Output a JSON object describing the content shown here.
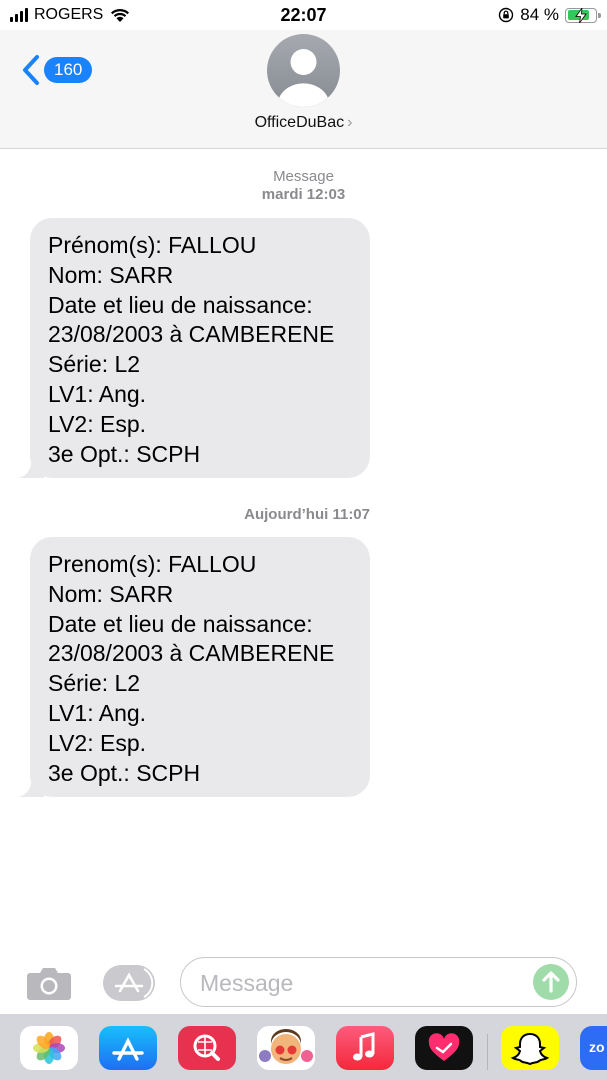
{
  "status_bar": {
    "carrier": "ROGERS",
    "time": "22:07",
    "battery_percent": "84 %",
    "battery_level": 0.84
  },
  "header": {
    "back_count": "160",
    "contact_name": "OfficeDuBac",
    "chevron": "›"
  },
  "messages": [
    {
      "timestamp_label": "Message",
      "timestamp": "mardi 12:03",
      "lines": [
        "Prénom(s): FALLOU",
        "Nom: SARR",
        "Date et lieu de naissance:",
        "23/08/2003 à CAMBERENE",
        "Série: L2",
        "LV1: Ang.",
        "LV2: Esp.",
        "3e Opt.: SCPH"
      ]
    },
    {
      "timestamp": "Aujourd’hui 11:07",
      "lines": [
        "Prenom(s): FALLOU",
        "Nom: SARR",
        "Date et lieu de naissance:",
        "23/08/2003 à CAMBERENE",
        "Série: L2",
        "LV1: Ang.",
        "LV2: Esp.",
        "3e Opt.: SCPH"
      ]
    }
  ],
  "input_bar": {
    "placeholder": "Message"
  },
  "dock": {
    "apps": [
      "photos-icon",
      "app-store-icon",
      "web-search-icon",
      "memoji-icon",
      "music-icon",
      "fitness-heart-icon",
      "snapchat-icon",
      "zoom-icon"
    ],
    "zoom_label": "zo"
  },
  "colors": {
    "accent": "#1a82fb",
    "bubble_gray": "#e9e9eb",
    "send_green": "#9fdcaa"
  }
}
